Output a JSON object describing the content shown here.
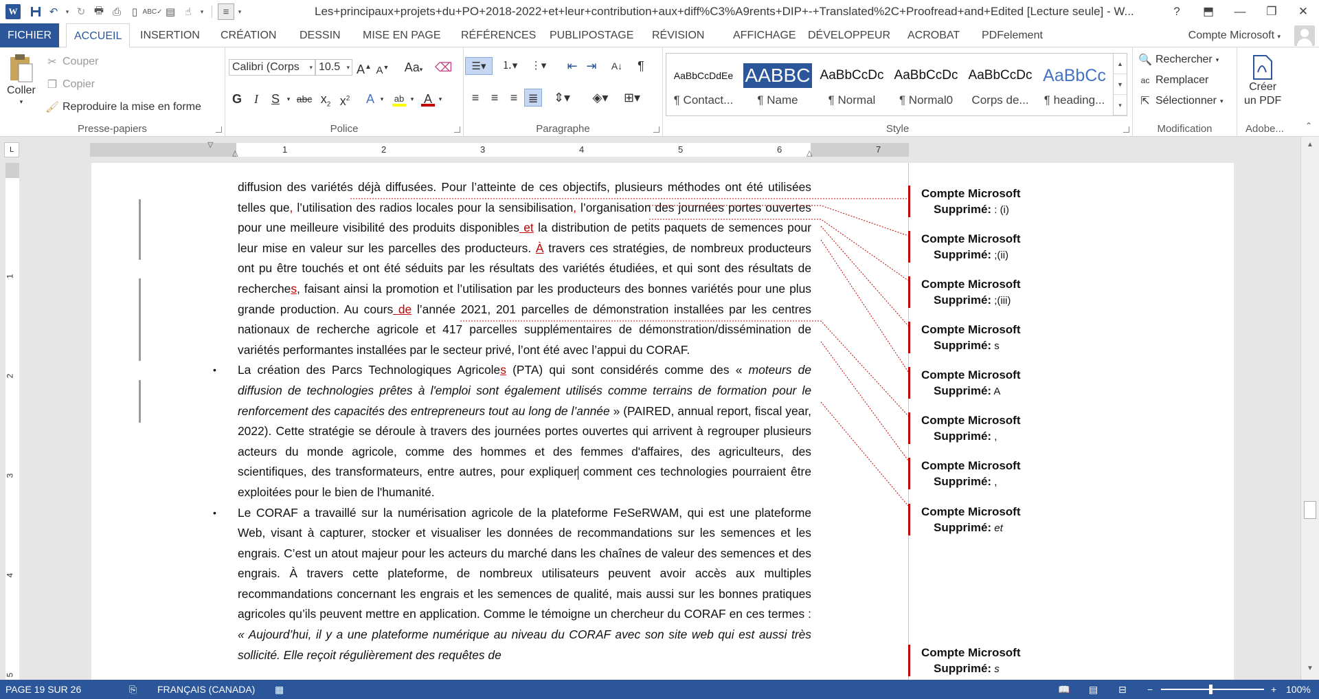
{
  "titlebar": {
    "document_title": "Les+principaux+projets+du+PO+2018-2022+et+leur+contribution+aux+diff%C3%A9rents+DIP+-+Translated%2C+Proofread+and+Edited [Lecture seule] - W...",
    "help": "?"
  },
  "tabs": {
    "file": "FICHIER",
    "items": [
      "ACCUEIL",
      "INSERTION",
      "CRÉATION",
      "DESSIN",
      "MISE EN PAGE",
      "RÉFÉRENCES",
      "PUBLIPOSTAGE",
      "RÉVISION",
      "AFFICHAGE",
      "DÉVELOPPEUR",
      "ACROBAT",
      "PDFelement"
    ],
    "account": "Compte Microsoft"
  },
  "ribbon": {
    "clipboard": {
      "paste": "Coller",
      "cut": "Couper",
      "copy": "Copier",
      "format_painter": "Reproduire la mise en forme",
      "label": "Presse-papiers"
    },
    "font": {
      "font_name": "Calibri (Corps",
      "font_size": "10.5",
      "label": "Police",
      "bold": "G",
      "italic": "I",
      "underline": "S",
      "strike": "abc",
      "aa": "Aa",
      "highlight_color": "#ffff00",
      "font_color": "#c00000"
    },
    "paragraph": {
      "label": "Paragraphe"
    },
    "styles": {
      "label": "Style",
      "items": [
        {
          "preview": "AaBbCcDdEe",
          "name": "¶ Contact..."
        },
        {
          "preview": "AABBC",
          "name": "¶ Name"
        },
        {
          "preview": "AaBbCcDc",
          "name": "¶ Normal"
        },
        {
          "preview": "AaBbCcDc",
          "name": "¶ Normal0"
        },
        {
          "preview": "AaBbCcDc",
          "name": "Corps de..."
        },
        {
          "preview": "AaBbCc",
          "name": "¶ heading..."
        }
      ]
    },
    "editing": {
      "find": "Rechercher",
      "replace": "Remplacer",
      "select": "Sélectionner",
      "label": "Modification"
    },
    "adobe": {
      "create_pdf_1": "Créer",
      "create_pdf_2": "un PDF",
      "label": "Adobe..."
    }
  },
  "ruler": {
    "numbers": [
      "1",
      "2",
      "3",
      "4",
      "5",
      "6",
      "7"
    ],
    "vertical_numbers": [
      "1",
      "2",
      "3",
      "4",
      "5"
    ]
  },
  "document": {
    "p1": [
      "diffusion des variétés déjà diffusées. Pour l’atteinte de ces objectifs, plusieurs méthodes ont été utilisées telles que",
      ",",
      " l’utilisation des radios locales pour la sensibilisation",
      ",",
      " l’organisation des journées portes ouvertes pour une meilleure visibilité des produits disponibles",
      " et",
      " la distribution de petits paquets de semences pour leur mise en valeur sur les parcelles des producteurs. ",
      "À",
      " travers ces stratégies, de nombreux producteurs ont pu être touchés et ont été séduits par les résultats des variétés étudiées, et qui sont des résultats de recherche",
      "s",
      ", faisant ainsi la promotion et l’utilisation par les producteurs des bonnes variétés pour une plus grande production. Au cours",
      " de",
      " l’année 2021, 201 parcelles de démonstration installées par les centres nationaux de recherche agricole et 417 parcelles supplémentaires de démonstration/dissémination de variétés performantes installées par le secteur privé, l’ont été avec l’appui du CORAF."
    ],
    "bullet1": [
      "La création des Parcs Technologiques Agricole",
      "s",
      " (PTA) qui sont considérés comme des « ",
      "moteurs de diffusion de technologies prêtes à l'emploi sont également utilisés comme terrains de formation pour le renforcement des capacités des entrepreneurs tout au long de l’année",
      " » (PAIRED, annual report, fiscal year, 2022). Cette stratégie se déroule à travers des journées portes ouvertes qui arrivent à regrouper plusieurs acteurs du monde agricole, comme des hommes et des femmes d'affaires, des agriculteurs, des scientifiques, des transformateurs, entre autres, pour expliquer",
      " comment ces technologies pourraient être exploitées pour le bien de l'humanité."
    ],
    "bullet2": [
      "Le CORAF a travaillé sur la numérisation agricole de la plateforme FeSeRWAM, qui est une plateforme Web, visant à capturer, stocker et visualiser les données de recommandations sur les semences et les engrais. C’est un atout majeur pour les acteurs du marché dans les chaînes de valeur des semences et des engrais. À travers cette plateforme, de nombreux utilisateurs peuvent avoir accès aux multiples recommandations concernant les engrais et les semences de qualité, mais aussi sur les bonnes pratiques agricoles qu’ils peuvent mettre en application. Comme le témoigne un chercheur du CORAF en ces termes : ",
      "« Aujourd’hui, il y a une plateforme numérique au niveau du CORAF avec son site web qui est aussi très sollicité. Elle reçoit régulièrement des requêtes de"
    ],
    "bullet_glyph": "•"
  },
  "comments": [
    {
      "author": "Compte Microsoft",
      "label": "Supprimé:",
      "text": " : (i)"
    },
    {
      "author": "Compte Microsoft",
      "label": "Supprimé:",
      "text": "  ;(ii)"
    },
    {
      "author": "Compte Microsoft",
      "label": "Supprimé:",
      "text": "  ;(iii)"
    },
    {
      "author": "Compte Microsoft",
      "label": "Supprimé:",
      "text": " s"
    },
    {
      "author": "Compte Microsoft",
      "label": "Supprimé:",
      "text": " A"
    },
    {
      "author": "Compte Microsoft",
      "label": "Supprimé:",
      "text": " ,"
    },
    {
      "author": "Compte Microsoft",
      "label": "Supprimé:",
      "text": " ,"
    },
    {
      "author": "Compte Microsoft",
      "label": "Supprimé:",
      "text": " et"
    },
    {
      "author": "Compte Microsoft",
      "label": "Supprimé:",
      "text": " s"
    }
  ],
  "statusbar": {
    "page": "PAGE 19 SUR 26",
    "language": "FRANÇAIS (CANADA)",
    "zoom": "100%"
  },
  "colors": {
    "accent": "#2b579a",
    "revision": "#c00000"
  }
}
